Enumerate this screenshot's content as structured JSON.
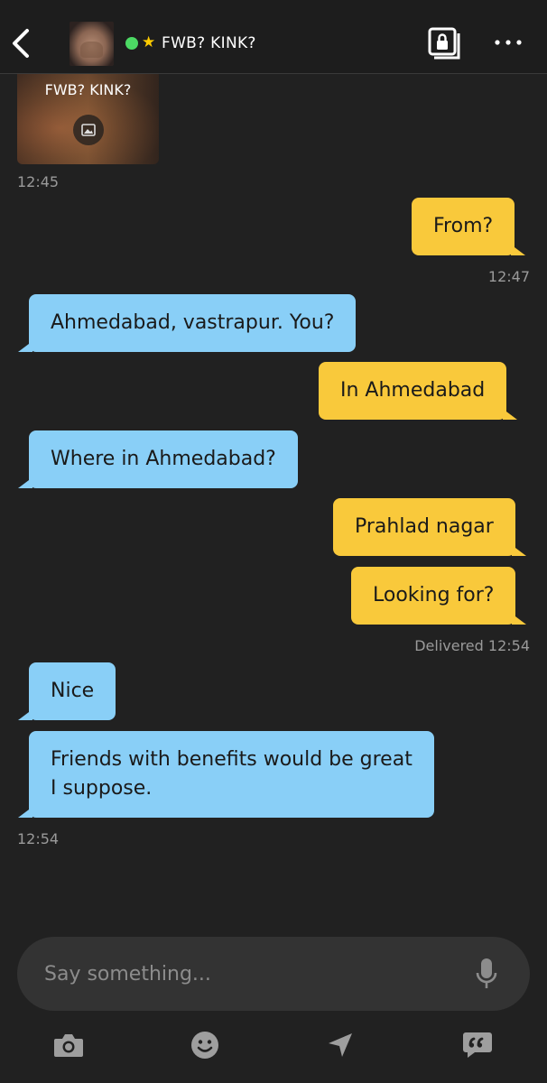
{
  "header": {
    "title": "FWB?  KINK?",
    "back_icon": "chevron-left-icon",
    "album_icon": "private-album-lock-icon",
    "more_icon": "more-dots-icon",
    "online_color": "#4cd964",
    "favorite_color": "#ffcc00"
  },
  "image_message": {
    "caption": "FWB?  KINK?",
    "icon": "photo-icon",
    "time": "12:45"
  },
  "messages": [
    {
      "side": "sent",
      "text": "From?"
    },
    {
      "side": "sent_time",
      "text": "12:47"
    },
    {
      "side": "recv",
      "text": "Ahmedabad, vastrapur. You?"
    },
    {
      "side": "sent",
      "text": "In Ahmedabad"
    },
    {
      "side": "recv",
      "text": "Where in Ahmedabad?"
    },
    {
      "side": "sent",
      "text": "Prahlad nagar"
    },
    {
      "side": "sent",
      "text": "Looking for?"
    },
    {
      "side": "sent_time",
      "text": "Delivered 12:54"
    },
    {
      "side": "recv",
      "text": "Nice"
    },
    {
      "side": "recv",
      "text": "Friends with benefits would be great\nI suppose."
    },
    {
      "side": "recv_time",
      "text": "12:54"
    }
  ],
  "compose": {
    "placeholder": "Say something...",
    "mic_icon": "microphone-icon"
  },
  "toolbar": {
    "items": [
      "camera-icon",
      "smiley-icon",
      "location-arrow-icon",
      "saved-phrases-icon"
    ]
  },
  "colors": {
    "background": "#212121",
    "sent_bubble": "#f9c93b",
    "received_bubble": "#89cff7",
    "timestamp": "#9a9a9a"
  }
}
